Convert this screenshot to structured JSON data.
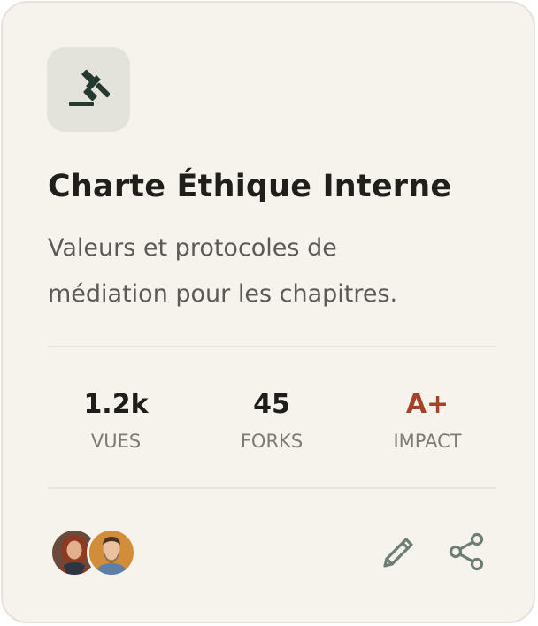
{
  "card": {
    "icon": "gavel-icon",
    "title": "Charte Éthique Interne",
    "description": "Valeurs et protocoles de médiation pour les chapitres.",
    "stats": [
      {
        "value": "1.2k",
        "label": "VUES"
      },
      {
        "value": "45",
        "label": "FORKS"
      },
      {
        "value": "A+",
        "label": "IMPACT"
      }
    ],
    "collaborators": [
      "avatar-woman-icon",
      "avatar-man-icon"
    ],
    "actions": [
      "edit-icon",
      "share-icon"
    ]
  },
  "colors": {
    "background": "#f6f2ec",
    "icon_tile": "#e3e3dc",
    "icon_color": "#24392f",
    "title": "#211f1b",
    "impact_accent": "#a3442a",
    "action_icons": "#6d7e72"
  }
}
